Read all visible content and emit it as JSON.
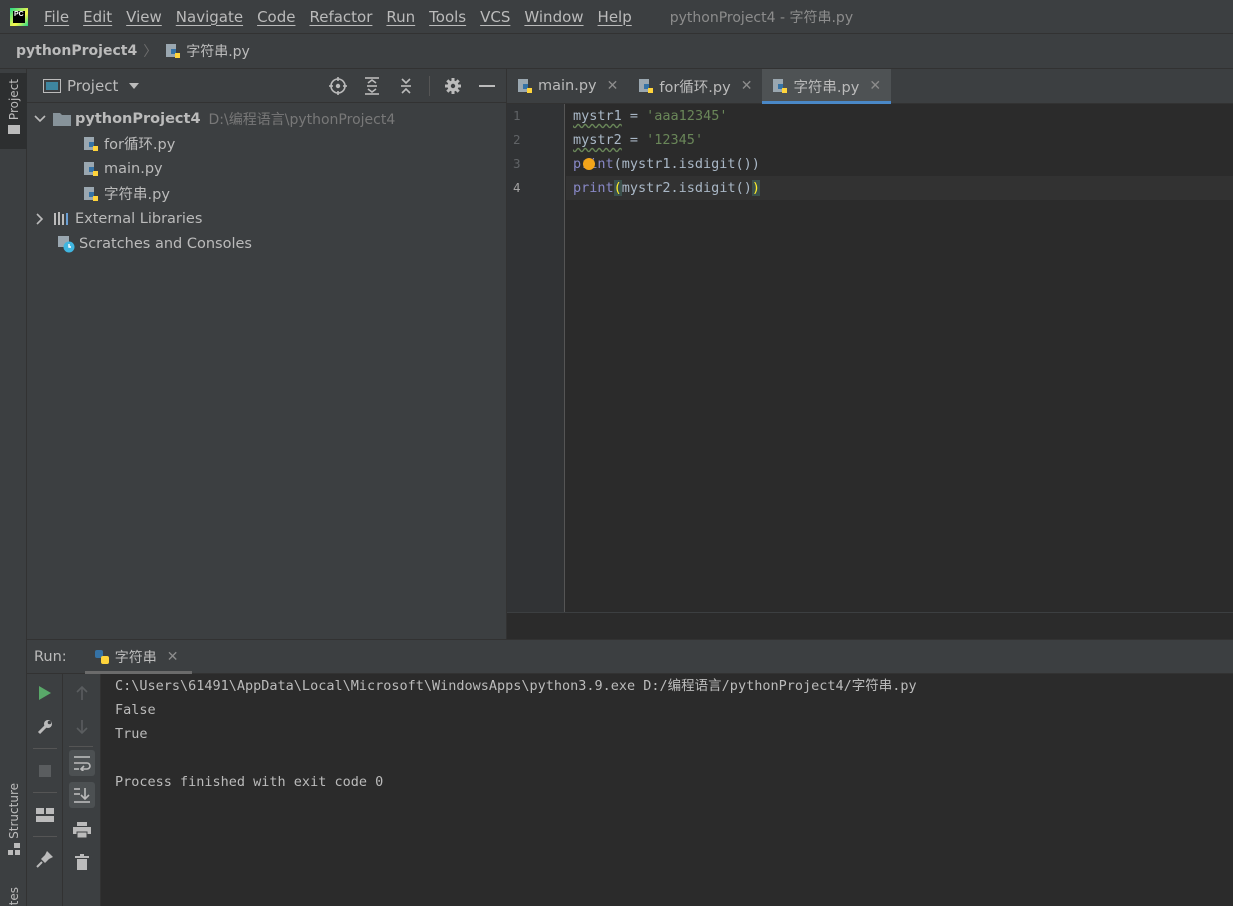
{
  "app": {
    "logo_text": "PC",
    "window_title": "pythonProject4 - 字符串.py",
    "menu": [
      "File",
      "Edit",
      "View",
      "Navigate",
      "Code",
      "Refactor",
      "Run",
      "Tools",
      "VCS",
      "Window",
      "Help"
    ]
  },
  "breadcrumb": {
    "project": "pythonProject4",
    "file": "字符串.py"
  },
  "left_strip": {
    "project_tab": "Project",
    "structure_tab": "Structure",
    "favorites_tab": "Favorites"
  },
  "project_panel": {
    "title": "Project",
    "tree": {
      "root_name": "pythonProject4",
      "root_path": "D:\\编程语言\\pythonProject4",
      "files": [
        "for循环.py",
        "main.py",
        "字符串.py"
      ],
      "external_libraries": "External Libraries",
      "scratches": "Scratches and Consoles"
    }
  },
  "editor": {
    "tabs": [
      {
        "label": "main.py",
        "active": false
      },
      {
        "label": "for循环.py",
        "active": false
      },
      {
        "label": "字符串.py",
        "active": true
      }
    ],
    "line_numbers": [
      "1",
      "2",
      "3",
      "4"
    ],
    "code": {
      "l1_var": "mystr1",
      "l1_eq": " = ",
      "l1_str": "'aaa12345'",
      "l2_var": "mystr2",
      "l2_eq": " = ",
      "l2_str": "'12345'",
      "l3_fn": "print",
      "l3_args": "(mystr1.isdigit())",
      "l4_fn": "print",
      "l4_open": "(",
      "l4_mid": "mystr2.isdigit()",
      "l4_close": ")"
    }
  },
  "run_panel": {
    "label": "Run:",
    "tab": "字符串",
    "console": [
      "C:\\Users\\61491\\AppData\\Local\\Microsoft\\WindowsApps\\python3.9.exe D:/编程语言/pythonProject4/字符串.py",
      "False",
      "True",
      "",
      "Process finished with exit code 0"
    ]
  },
  "colors": {
    "background": "#2b2b2b",
    "panel": "#3c3f41",
    "accent_tab": "#4a88c7",
    "string": "#6a8759",
    "builtin": "#8888c6",
    "run_green": "#59a869"
  }
}
